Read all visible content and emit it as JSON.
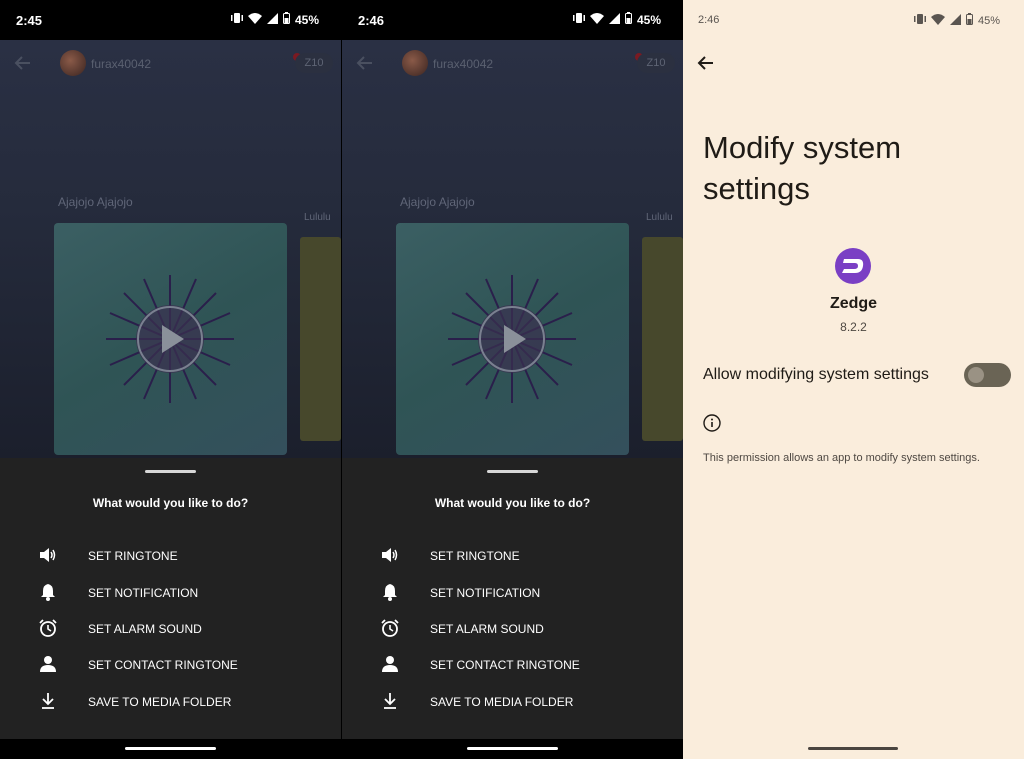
{
  "screens": [
    {
      "status": {
        "time": "2:45",
        "battery": "45%"
      },
      "header": {
        "username": "furax40042",
        "z_badge": "Z10"
      },
      "track_title": "Ajajojo Ajajojo",
      "next_title": "Lululu",
      "sheet": {
        "question": "What would you like to do?",
        "options": [
          {
            "label": "SET RINGTONE",
            "icon": "speaker-icon"
          },
          {
            "label": "SET NOTIFICATION",
            "icon": "bell-icon"
          },
          {
            "label": "SET ALARM SOUND",
            "icon": "alarm-icon"
          },
          {
            "label": "SET CONTACT RINGTONE",
            "icon": "person-icon"
          },
          {
            "label": "SAVE TO MEDIA FOLDER",
            "icon": "download-icon"
          }
        ]
      }
    },
    {
      "status": {
        "time": "2:46",
        "battery": "45%"
      },
      "header": {
        "username": "furax40042",
        "z_badge": "Z10"
      },
      "track_title": "Ajajojo Ajajojo",
      "next_title": "Lululu",
      "sheet": {
        "question": "What would you like to do?",
        "options": [
          {
            "label": "SET RINGTONE",
            "icon": "speaker-icon"
          },
          {
            "label": "SET NOTIFICATION",
            "icon": "bell-icon"
          },
          {
            "label": "SET ALARM SOUND",
            "icon": "alarm-icon"
          },
          {
            "label": "SET CONTACT RINGTONE",
            "icon": "person-icon"
          },
          {
            "label": "SAVE TO MEDIA FOLDER",
            "icon": "download-icon"
          }
        ]
      }
    }
  ],
  "settings": {
    "status": {
      "time": "2:46",
      "battery": "45%"
    },
    "title": "Modify system settings",
    "app_name": "Zedge",
    "app_version": "8.2.2",
    "toggle_label": "Allow modifying system settings",
    "toggle_on": false,
    "description": "This permission allows an app to modify system settings."
  },
  "colors": {
    "sheet_bg": "#222222",
    "settings_bg": "#faeddc",
    "zedge_purple": "#7a3fc4"
  }
}
